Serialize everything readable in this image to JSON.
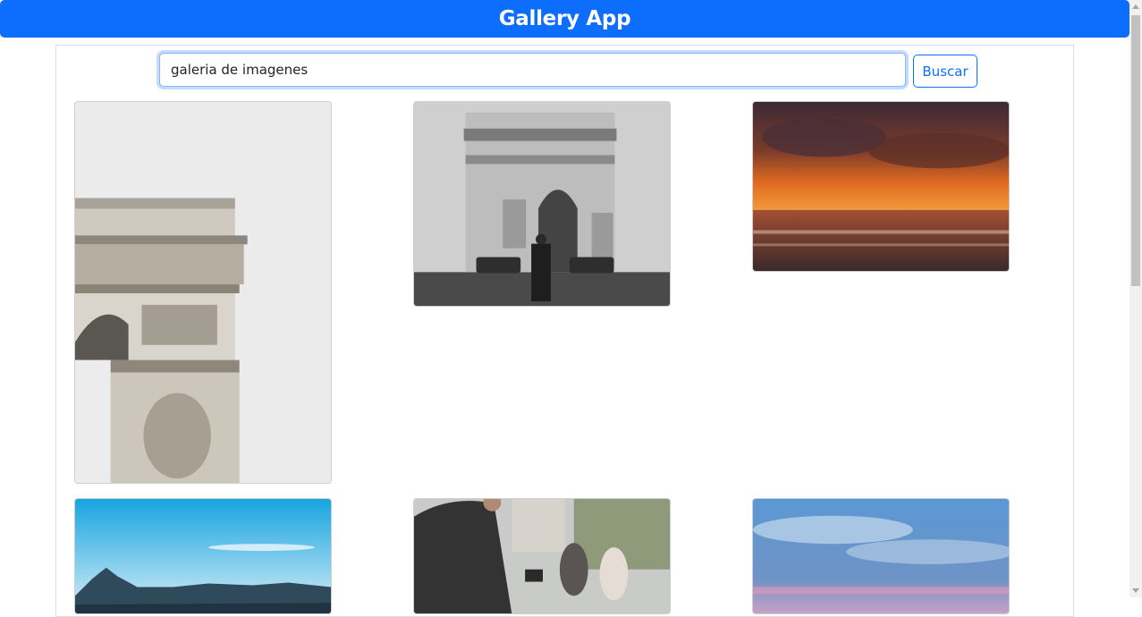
{
  "header": {
    "title": "Gallery App"
  },
  "search": {
    "value": "galeria de imagenes",
    "button_label": "Buscar"
  },
  "colors": {
    "primary": "#0d6efd",
    "background": "#ffffff"
  },
  "gallery": {
    "images": [
      {
        "subject": "arc-de-triomphe-color-closeup"
      },
      {
        "subject": "arc-de-triomphe-black-and-white-with-person"
      },
      {
        "subject": "ocean-sunset-clouds"
      },
      {
        "subject": "blue-sky-mountain-coastline"
      },
      {
        "subject": "man-holding-phone-street-crowd"
      },
      {
        "subject": "blue-cloudy-sky-pink-horizon"
      }
    ]
  }
}
